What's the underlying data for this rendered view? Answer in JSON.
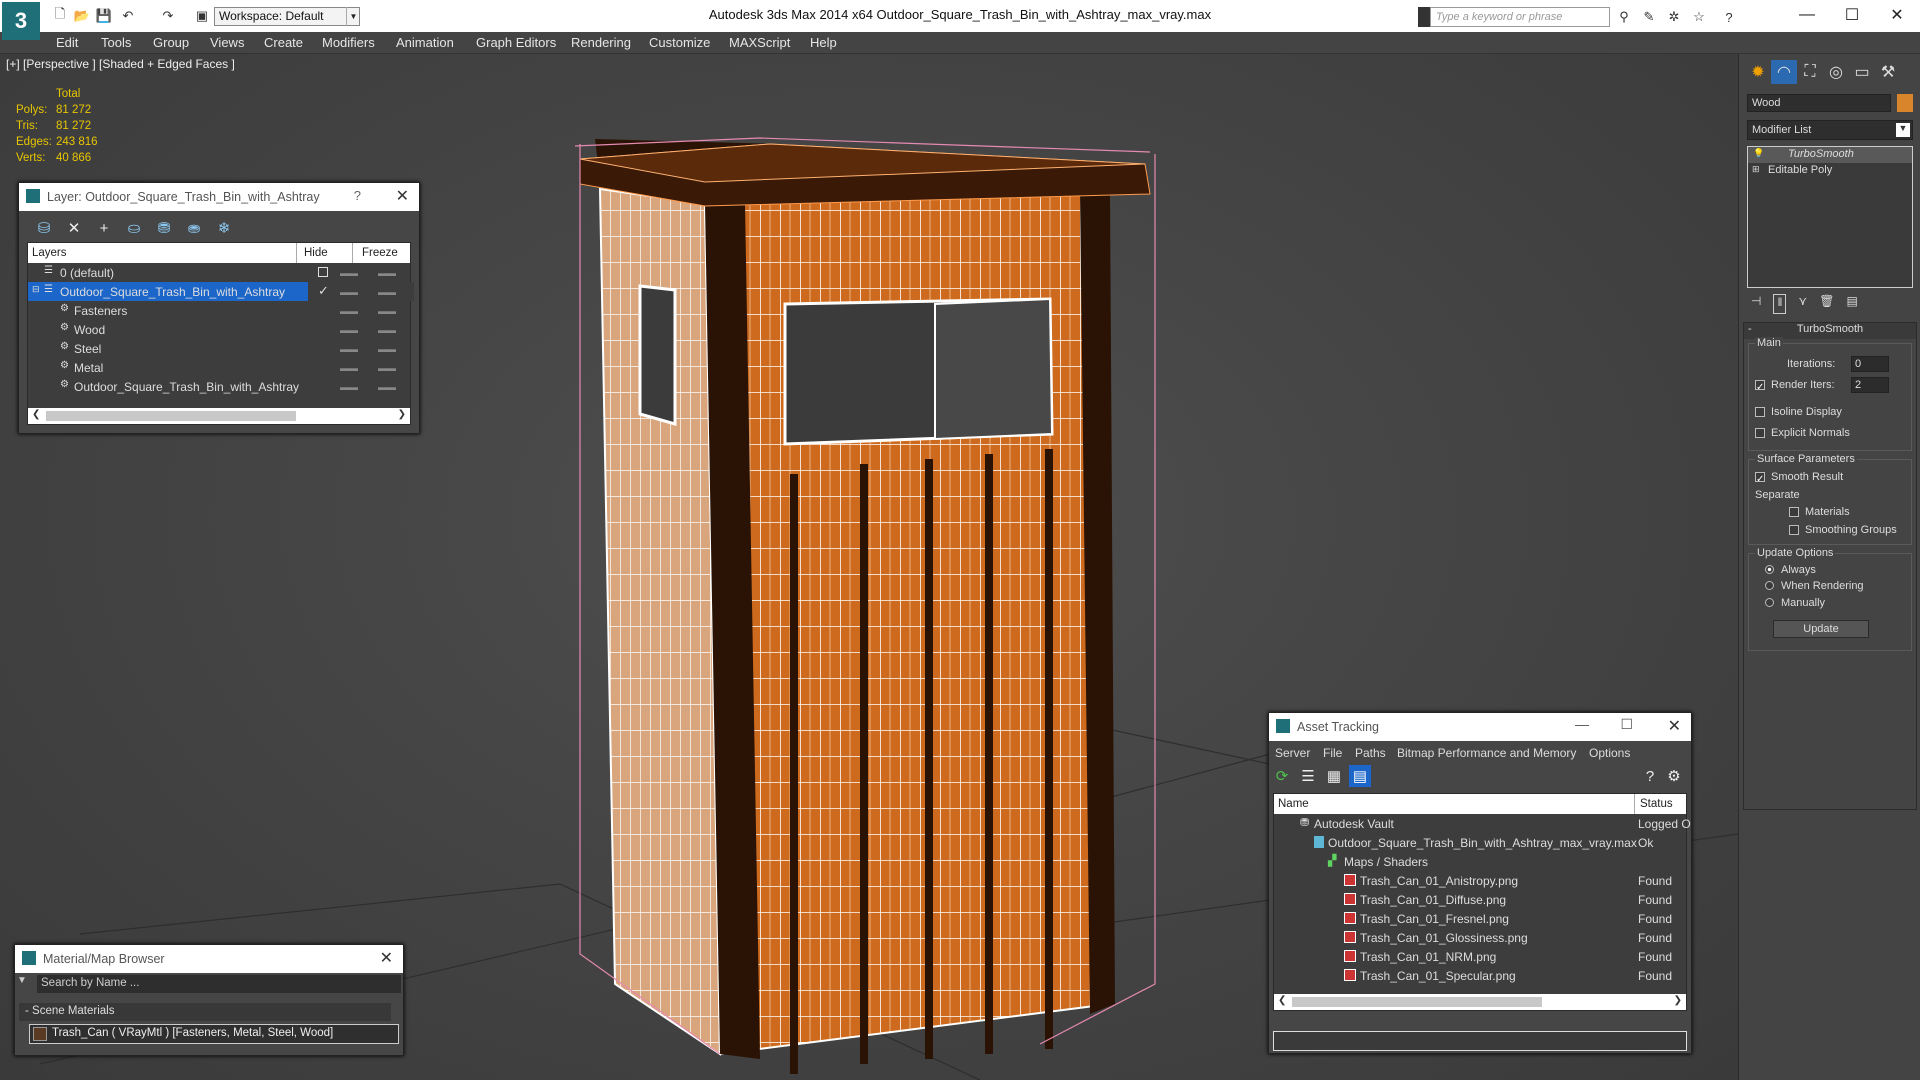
{
  "app": {
    "title": "Autodesk 3ds Max  2014 x64      Outdoor_Square_Trash_Bin_with_Ashtray_max_vray.max",
    "workspace": "Workspace: Default",
    "search_placeholder": "Type a keyword or phrase",
    "logo": "3"
  },
  "menu": [
    "Edit",
    "Tools",
    "Group",
    "Views",
    "Create",
    "Modifiers",
    "Animation",
    "Graph Editors",
    "Rendering",
    "Customize",
    "MAXScript",
    "Help"
  ],
  "viewport": {
    "label": "[+] [Perspective ] [Shaded + Edged Faces ]",
    "stats": {
      "header": "Total",
      "rows": [
        {
          "label": "Polys:",
          "value": "81 272"
        },
        {
          "label": "Tris:",
          "value": "81 272"
        },
        {
          "label": "Edges:",
          "value": "243 816"
        },
        {
          "label": "Verts:",
          "value": "40 866"
        }
      ]
    }
  },
  "layer_window": {
    "title": "Layer: Outdoor_Square_Trash_Bin_with_Ashtray",
    "help": "?",
    "columns": {
      "layers": "Layers",
      "hide": "Hide",
      "freeze": "Freeze"
    },
    "rows": [
      {
        "name": "0 (default)",
        "indent": 0,
        "selected": false
      },
      {
        "name": "Outdoor_Square_Trash_Bin_with_Ashtray",
        "indent": 0,
        "selected": true
      },
      {
        "name": "Fasteners",
        "indent": 1,
        "selected": false
      },
      {
        "name": "Wood",
        "indent": 1,
        "selected": false
      },
      {
        "name": "Steel",
        "indent": 1,
        "selected": false
      },
      {
        "name": "Metal",
        "indent": 1,
        "selected": false
      },
      {
        "name": "Outdoor_Square_Trash_Bin_with_Ashtray",
        "indent": 1,
        "selected": false
      }
    ]
  },
  "material_browser": {
    "title": "Material/Map Browser",
    "search_placeholder": "Search by Name ...",
    "section": "- Scene Materials",
    "item": "Trash_Can  ( VRayMtl )  [Fasteners, Metal, Steel, Wood]"
  },
  "asset_tracking": {
    "title": "Asset Tracking",
    "menu": [
      "Server",
      "File",
      "Paths",
      "Bitmap Performance and Memory",
      "Options"
    ],
    "columns": {
      "name": "Name",
      "status": "Status"
    },
    "rows": [
      {
        "name": "Autodesk Vault",
        "status": "Logged O",
        "indent": 0,
        "icon": "vault-icon"
      },
      {
        "name": "Outdoor_Square_Trash_Bin_with_Ashtray_max_vray.max",
        "status": "Ok",
        "indent": 1,
        "icon": "max-file-icon"
      },
      {
        "name": "Maps / Shaders",
        "status": "",
        "indent": 2,
        "icon": "maps-folder-icon"
      },
      {
        "name": "Trash_Can_01_Anistropy.png",
        "status": "Found",
        "indent": 3,
        "icon": "png-icon"
      },
      {
        "name": "Trash_Can_01_Diffuse.png",
        "status": "Found",
        "indent": 3,
        "icon": "png-icon"
      },
      {
        "name": "Trash_Can_01_Fresnel.png",
        "status": "Found",
        "indent": 3,
        "icon": "png-icon"
      },
      {
        "name": "Trash_Can_01_Glossiness.png",
        "status": "Found",
        "indent": 3,
        "icon": "png-icon"
      },
      {
        "name": "Trash_Can_01_NRM.png",
        "status": "Found",
        "indent": 3,
        "icon": "png-icon"
      },
      {
        "name": "Trash_Can_01_Specular.png",
        "status": "Found",
        "indent": 3,
        "icon": "png-icon"
      }
    ]
  },
  "command_panel": {
    "object_name": "Wood",
    "object_color": "#d9852b",
    "modifier_list": "Modifier List",
    "stack": [
      "TurboSmooth",
      "Editable Poly"
    ],
    "rollout_title": "TurboSmooth",
    "main_group": "Main",
    "iterations_label": "Iterations:",
    "iterations_value": "0",
    "render_iters_label": "Render Iters:",
    "render_iters_value": "2",
    "render_iters_checked": true,
    "isoline_label": "Isoline Display",
    "explicit_normals_label": "Explicit Normals",
    "surface_group": "Surface Parameters",
    "smooth_result_label": "Smooth Result",
    "separate_label": "Separate",
    "materials_label": "Materials",
    "smoothing_groups_label": "Smoothing Groups",
    "update_group": "Update Options",
    "always_label": "Always",
    "when_rendering_label": "When Rendering",
    "manually_label": "Manually",
    "update_button": "Update"
  },
  "colors": {
    "wood": "#c8631a",
    "wire": "#ffffff",
    "selection": "#1c66c9",
    "accent": "#e8c600"
  }
}
